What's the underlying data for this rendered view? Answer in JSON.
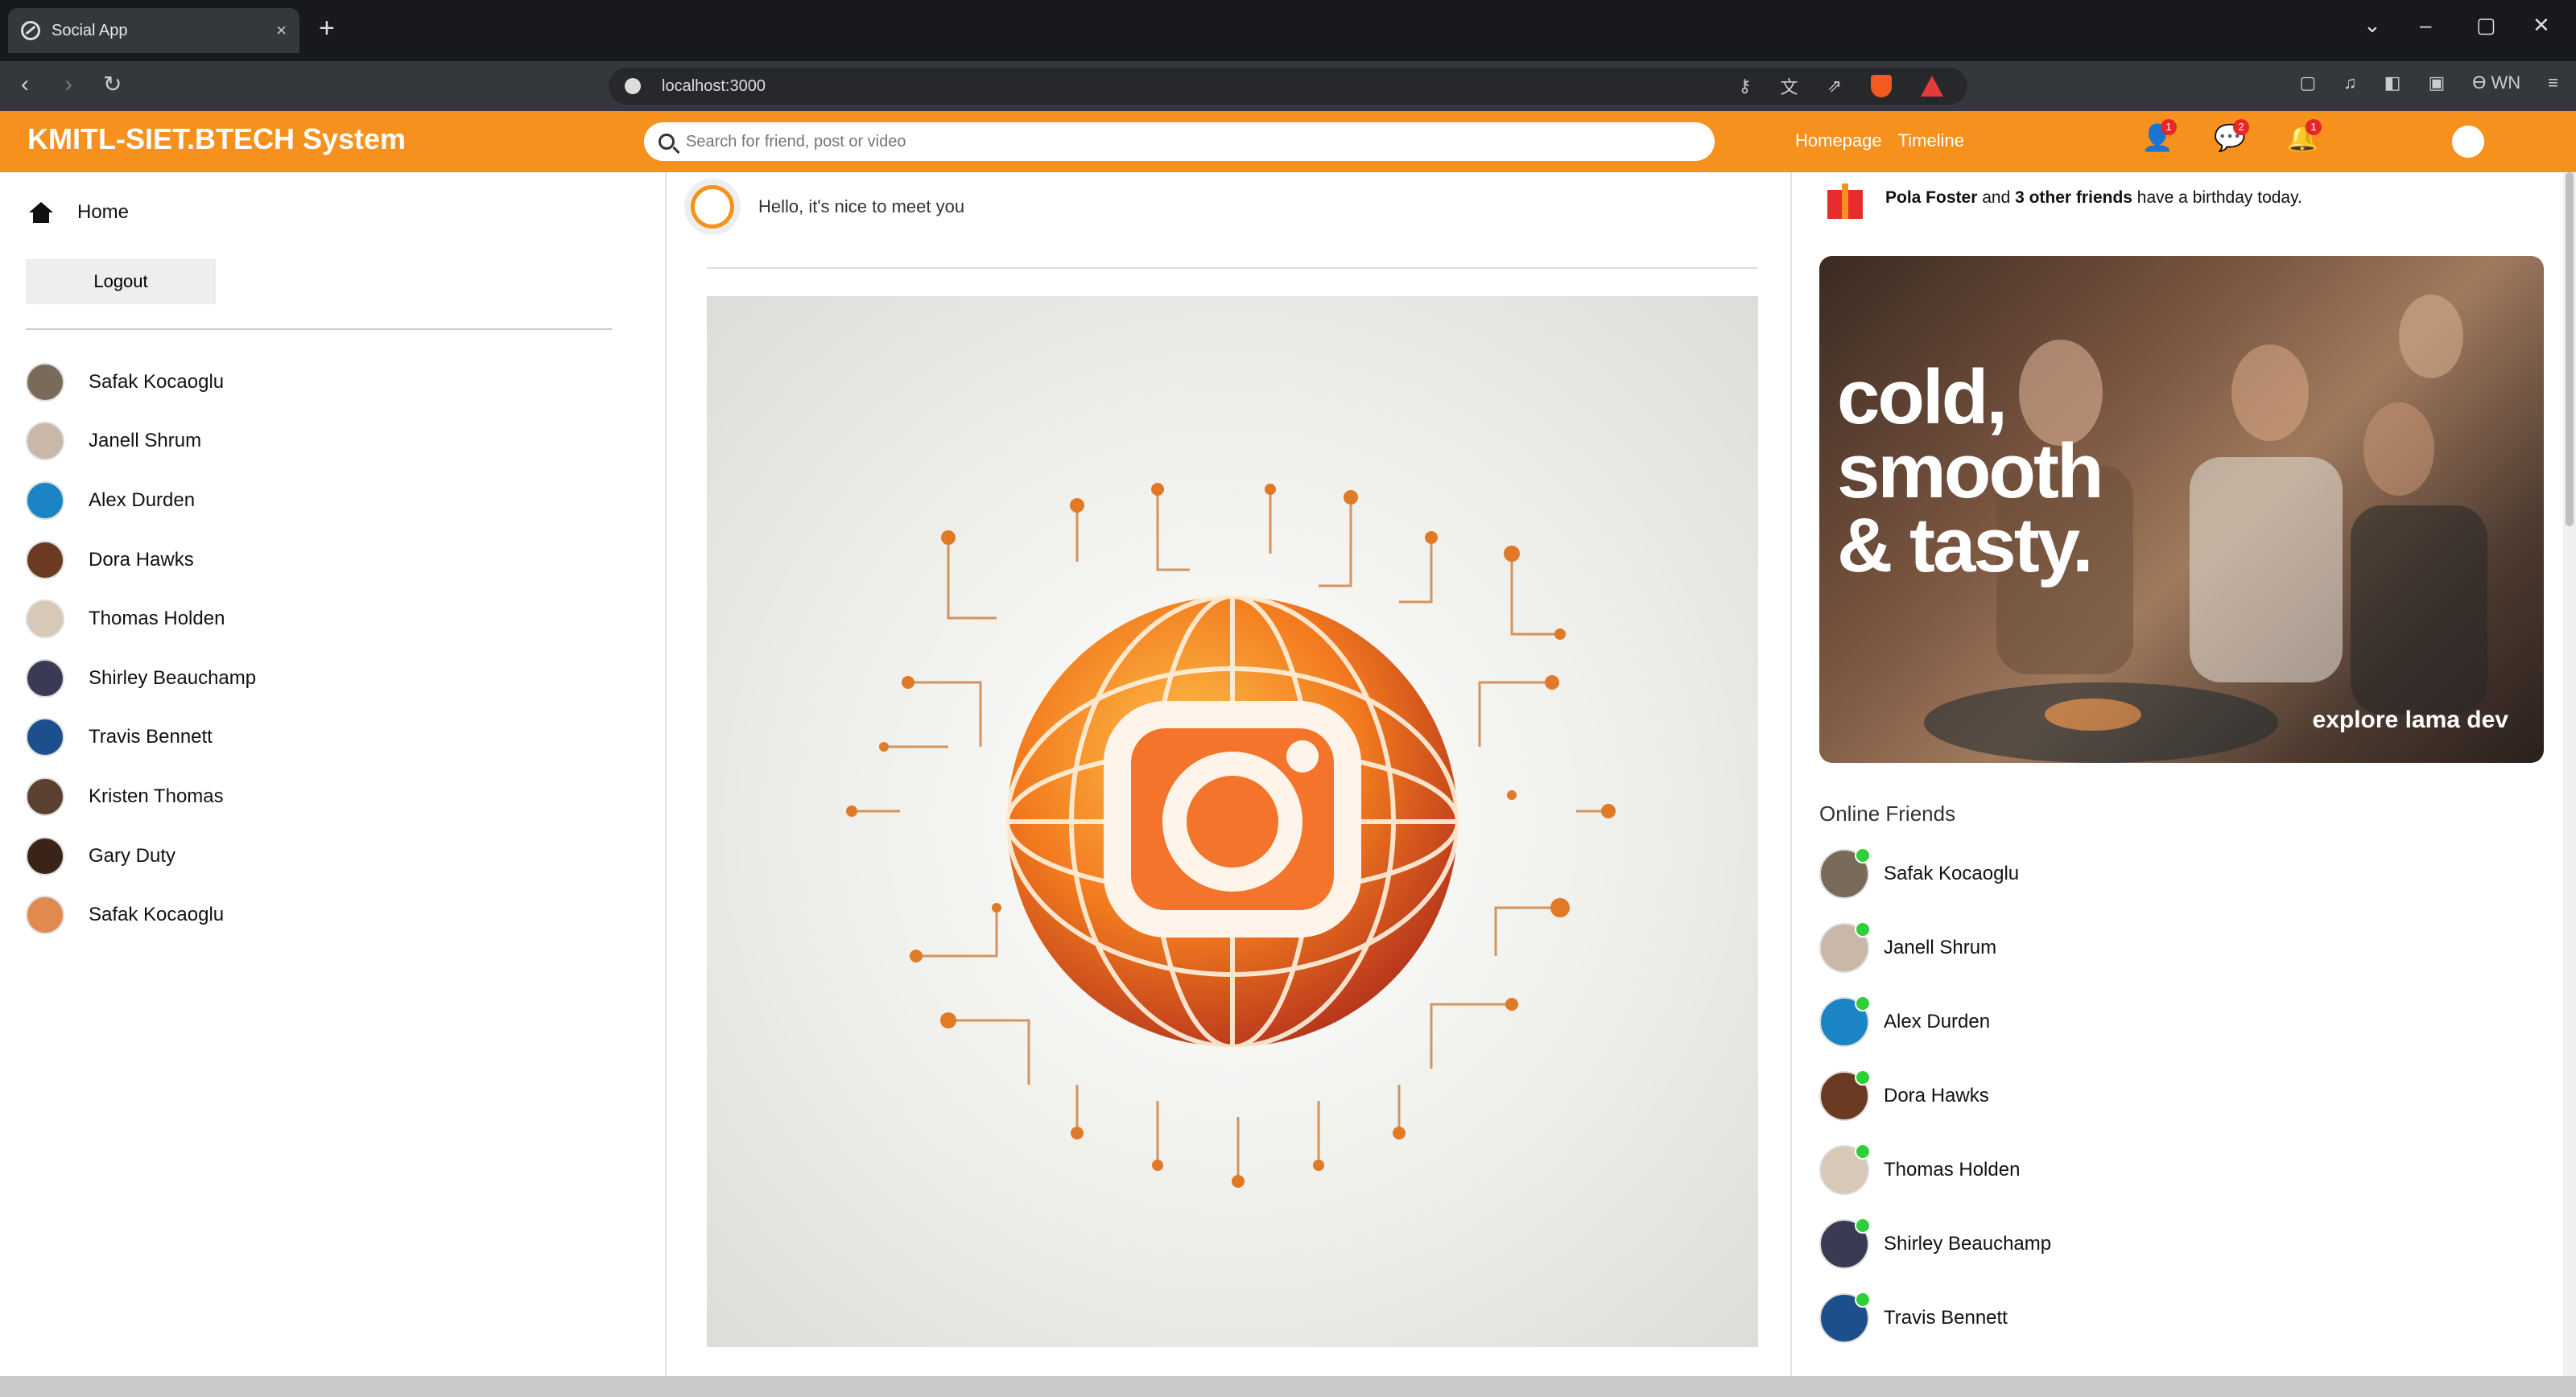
{
  "browser": {
    "tab_title": "Social App",
    "tab_close": "×",
    "new_tab": "+",
    "url": "localhost:3000",
    "profile_label": "ϴ WN",
    "window_controls": [
      "⌄",
      "–",
      "▢",
      "✕"
    ]
  },
  "topbar": {
    "logo": "KMITL-SIET.BTECH System",
    "search_placeholder": "Search for friend, post or video",
    "links": [
      "Homepage",
      "Timeline"
    ],
    "icons": [
      {
        "name": "person-icon",
        "badge": "1"
      },
      {
        "name": "chat-icon",
        "badge": "2"
      },
      {
        "name": "notifications-icon",
        "badge": "1"
      }
    ],
    "accent_color": "#f6911e"
  },
  "sidebar": {
    "home_label": "Home",
    "logout_label": "Logout",
    "friends": [
      {
        "name": "Safak Kocaoglu",
        "color": "#7a6a5a"
      },
      {
        "name": "Janell Shrum",
        "color": "#c9b8a8"
      },
      {
        "name": "Alex Durden",
        "color": "#1b84c5"
      },
      {
        "name": "Dora Hawks",
        "color": "#6b3a22"
      },
      {
        "name": "Thomas Holden",
        "color": "#d8c8b8"
      },
      {
        "name": "Shirley Beauchamp",
        "color": "#3a3a55"
      },
      {
        "name": "Travis Bennett",
        "color": "#1c4f8c"
      },
      {
        "name": "Kristen Thomas",
        "color": "#5a4030"
      },
      {
        "name": "Gary Duty",
        "color": "#3a2418"
      },
      {
        "name": "Safak Kocaoglu",
        "color": "#e08a50"
      }
    ]
  },
  "feed": {
    "composer_placeholder": "Hello, it's nice to meet you"
  },
  "rightbar": {
    "birthday_text_bold": "Pola Foster",
    "birthday_text_and": " and ",
    "birthday_text_bold2": "3 other friends",
    "birthday_text_rest": " have a birthday today.",
    "ad_headline_lines": [
      "cold,",
      "smooth",
      "& tasty."
    ],
    "ad_footer": "explore lama dev",
    "online_title": "Online Friends",
    "online_friends": [
      {
        "name": "Safak Kocaoglu",
        "color": "#7a6a5a"
      },
      {
        "name": "Janell Shrum",
        "color": "#c9b8a8"
      },
      {
        "name": "Alex Durden",
        "color": "#1b84c5"
      },
      {
        "name": "Dora Hawks",
        "color": "#6b3a22"
      },
      {
        "name": "Thomas Holden",
        "color": "#d8c8b8"
      },
      {
        "name": "Shirley Beauchamp",
        "color": "#3a3a55"
      },
      {
        "name": "Travis Bennett",
        "color": "#1c4f8c"
      }
    ]
  }
}
